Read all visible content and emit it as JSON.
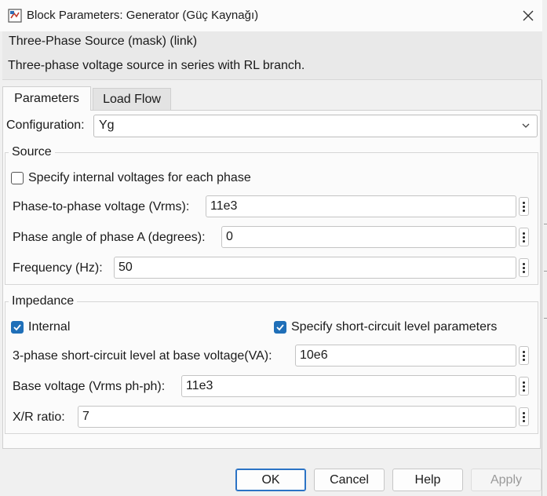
{
  "window": {
    "title": "Block Parameters: Generator (Güç Kaynağı)"
  },
  "mask": {
    "title": "Three-Phase Source (mask) (link)",
    "description": "Three-phase voltage source in series with RL branch."
  },
  "tabs": [
    {
      "label": "Parameters",
      "active": true
    },
    {
      "label": "Load Flow",
      "active": false
    }
  ],
  "configuration": {
    "label": "Configuration:",
    "value": "Yg"
  },
  "source": {
    "legend": "Source",
    "specify_internal": {
      "label": "Specify internal voltages for each phase",
      "checked": false
    },
    "phase_voltage": {
      "label": "Phase-to-phase voltage (Vrms):",
      "value": "11e3"
    },
    "phase_angle": {
      "label": "Phase angle of phase A (degrees):",
      "value": "0"
    },
    "frequency": {
      "label": "Frequency (Hz):",
      "value": "50"
    }
  },
  "impedance": {
    "legend": "Impedance",
    "internal": {
      "label": "Internal",
      "checked": true
    },
    "short_circuit_params": {
      "label": "Specify short-circuit level parameters",
      "checked": true
    },
    "sc_level": {
      "label": "3-phase short-circuit level at base voltage(VA):",
      "value": "10e6"
    },
    "base_voltage": {
      "label": "Base voltage (Vrms ph-ph):",
      "value": "11e3"
    },
    "xr_ratio": {
      "label": "X/R ratio:",
      "value": "7"
    }
  },
  "buttons": {
    "ok": "OK",
    "cancel": "Cancel",
    "help": "Help",
    "apply": "Apply"
  },
  "colors": {
    "accent": "#1f6fb8",
    "ok_border": "#2b73c5"
  }
}
